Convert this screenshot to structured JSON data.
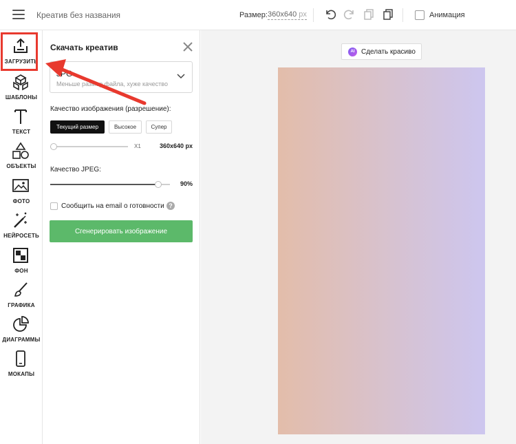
{
  "topbar": {
    "doc_title": "Креатив без названия",
    "size_label": "Размер:",
    "size_value": "360x640",
    "size_unit": "px",
    "animation_label": "Анимация"
  },
  "sidebar": {
    "items": [
      {
        "label": "ЗАГРУЗИТЬ",
        "icon": "upload-icon"
      },
      {
        "label": "ШАБЛОНЫ",
        "icon": "templates-icon"
      },
      {
        "label": "ТЕКСТ",
        "icon": "text-icon"
      },
      {
        "label": "ОБЪЕКТЫ",
        "icon": "shapes-icon"
      },
      {
        "label": "ФОТО",
        "icon": "photo-icon"
      },
      {
        "label": "НЕЙРОСЕТЬ",
        "icon": "magic-wand-icon"
      },
      {
        "label": "ФОН",
        "icon": "background-icon"
      },
      {
        "label": "ГРАФИКА",
        "icon": "brush-icon"
      },
      {
        "label": "ДИАГРАММЫ",
        "icon": "pie-chart-icon"
      },
      {
        "label": "МОКАПЫ",
        "icon": "phone-icon"
      }
    ]
  },
  "panel": {
    "title": "Скачать креатив",
    "format_value": "JPG",
    "format_hint": "Меньше размер файла, хуже качество",
    "quality_label": "Качество изображения (разрешение):",
    "quality_options": [
      "Текущий размер",
      "Высокое",
      "Супер"
    ],
    "scale_label": "X1",
    "resolution": "360x640 px",
    "jpeg_label": "Качество JPEG:",
    "jpeg_value": "90%",
    "jpeg_fraction": 0.9,
    "email_label": "Сообщить на email о готовности",
    "help_glyph": "?",
    "generate_label": "Сгенерировать изображение"
  },
  "workspace": {
    "ai_badge": "AI",
    "magic_label": "Сделать красиво"
  },
  "colors": {
    "accent_red": "#e8392e",
    "button_green": "#5cb96a",
    "canvas_left": "#e3bdaa",
    "canvas_right": "#cdc6ef"
  }
}
